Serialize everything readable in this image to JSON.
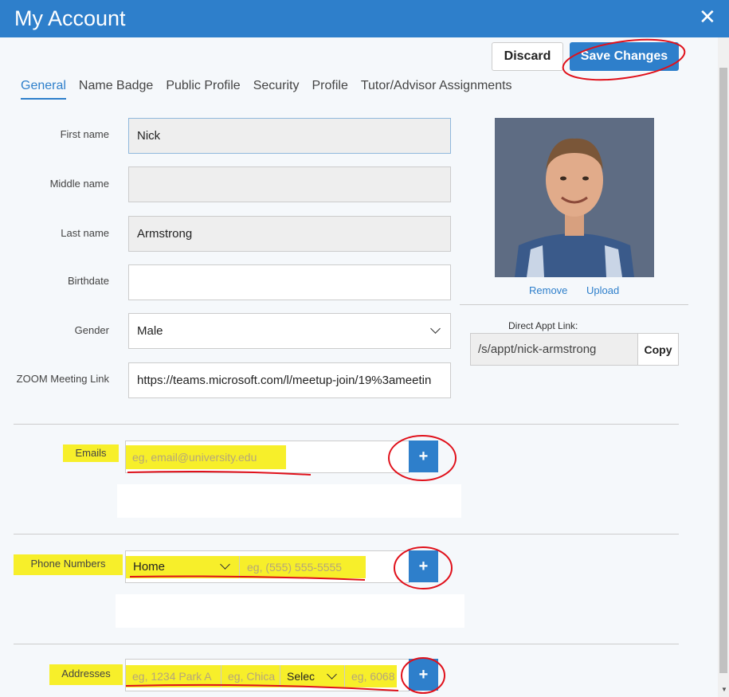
{
  "window": {
    "title": "My Account"
  },
  "actions": {
    "discard": "Discard",
    "save": "Save Changes"
  },
  "tabs": [
    {
      "label": "General",
      "active": true
    },
    {
      "label": "Name Badge"
    },
    {
      "label": "Public Profile"
    },
    {
      "label": "Security"
    },
    {
      "label": "Profile"
    },
    {
      "label": "Tutor/Advisor Assignments"
    }
  ],
  "form": {
    "first_name": {
      "label": "First name",
      "value": "Nick"
    },
    "middle_name": {
      "label": "Middle name",
      "value": ""
    },
    "last_name": {
      "label": "Last name",
      "value": "Armstrong"
    },
    "birthdate": {
      "label": "Birthdate",
      "value": ""
    },
    "gender": {
      "label": "Gender",
      "value": "Male"
    },
    "zoom": {
      "label": "ZOOM Meeting Link",
      "value": "https://teams.microsoft.com/l/meetup-join/19%3ameetin"
    }
  },
  "photo": {
    "remove": "Remove",
    "upload": "Upload"
  },
  "appt": {
    "label": "Direct Appt Link:",
    "value": "/s/appt/nick-armstrong",
    "copy": "Copy"
  },
  "emails": {
    "label": "Emails",
    "placeholder": "eg, email@university.edu",
    "add": "+"
  },
  "phones": {
    "label": "Phone Numbers",
    "type": "Home",
    "placeholder": "eg, (555) 555-5555",
    "add": "+"
  },
  "addresses": {
    "label": "Addresses",
    "street_placeholder": "eg, 1234 Park A",
    "city_placeholder": "eg, Chica",
    "state_select": "Selec",
    "zip_placeholder": "eg, 6068",
    "add": "+"
  },
  "colors": {
    "accent": "#2e7fcb",
    "highlight": "#f7ef2a",
    "annotation": "#e0101a"
  }
}
